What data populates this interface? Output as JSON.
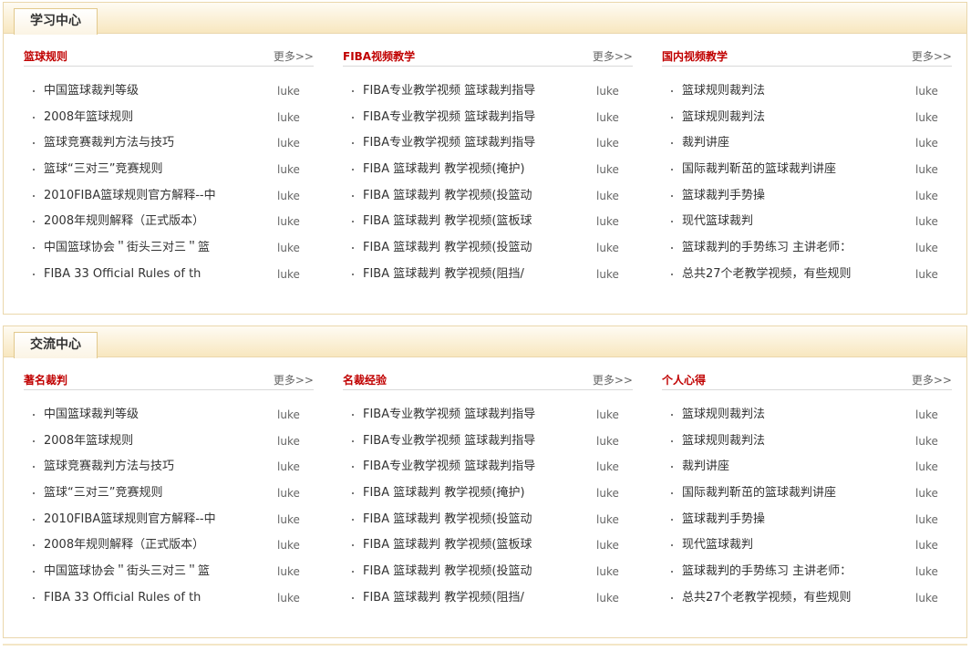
{
  "panels": [
    {
      "tab": "学习中心",
      "columns": [
        {
          "title": "篮球规则",
          "more": "更多>>",
          "items": [
            {
              "title": "中国篮球裁判等级",
              "author": "luke"
            },
            {
              "title": "2008年篮球规则",
              "author": "luke"
            },
            {
              "title": "篮球竞赛裁判方法与技巧",
              "author": "luke"
            },
            {
              "title": "篮球“三对三”竞赛规则",
              "author": "luke"
            },
            {
              "title": "2010FIBA篮球规则官方解释--中",
              "author": "luke"
            },
            {
              "title": "2008年规则解释（正式版本）",
              "author": "luke"
            },
            {
              "title": "中国篮球协会＂街头三对三＂篮",
              "author": "luke"
            },
            {
              "title": "FIBA 33 Official Rules of th",
              "author": "luke"
            }
          ]
        },
        {
          "title": "FIBA视频教学",
          "more": "更多>>",
          "items": [
            {
              "title": "FIBA专业教学视频 篮球裁判指导",
              "author": "luke"
            },
            {
              "title": "FIBA专业教学视频 篮球裁判指导",
              "author": "luke"
            },
            {
              "title": "FIBA专业教学视频 篮球裁判指导",
              "author": "luke"
            },
            {
              "title": "FIBA 篮球裁判 教学视频(掩护)",
              "author": "luke"
            },
            {
              "title": "FIBA 篮球裁判 教学视频(投篮动",
              "author": "luke"
            },
            {
              "title": "FIBA 篮球裁判 教学视频(篮板球",
              "author": "luke"
            },
            {
              "title": "FIBA 篮球裁判 教学视频(投篮动",
              "author": "luke"
            },
            {
              "title": "FIBA 篮球裁判 教学视频(阻挡/",
              "author": "luke"
            }
          ]
        },
        {
          "title": "国内视频教学",
          "more": "更多>>",
          "items": [
            {
              "title": "篮球规则裁判法",
              "author": "luke"
            },
            {
              "title": "篮球规则裁判法",
              "author": "luke"
            },
            {
              "title": "裁判讲座",
              "author": "luke"
            },
            {
              "title": "国际裁判靳茁的篮球裁判讲座",
              "author": "luke"
            },
            {
              "title": "篮球裁判手势操",
              "author": "luke"
            },
            {
              "title": "现代篮球裁判",
              "author": "luke"
            },
            {
              "title": "篮球裁判的手势练习 主讲老师：",
              "author": "luke"
            },
            {
              "title": "总共27个老教学视频，有些规则",
              "author": "luke"
            }
          ]
        }
      ]
    },
    {
      "tab": "交流中心",
      "columns": [
        {
          "title": "著名裁判",
          "more": "更多>>",
          "items": [
            {
              "title": "中国篮球裁判等级",
              "author": "luke"
            },
            {
              "title": "2008年篮球规则",
              "author": "luke"
            },
            {
              "title": "篮球竞赛裁判方法与技巧",
              "author": "luke"
            },
            {
              "title": "篮球“三对三”竞赛规则",
              "author": "luke"
            },
            {
              "title": "2010FIBA篮球规则官方解释--中",
              "author": "luke"
            },
            {
              "title": "2008年规则解释（正式版本）",
              "author": "luke"
            },
            {
              "title": "中国篮球协会＂街头三对三＂篮",
              "author": "luke"
            },
            {
              "title": "FIBA 33 Official Rules of th",
              "author": "luke"
            }
          ]
        },
        {
          "title": "名裁经验",
          "more": "更多>>",
          "items": [
            {
              "title": "FIBA专业教学视频 篮球裁判指导",
              "author": "luke"
            },
            {
              "title": "FIBA专业教学视频 篮球裁判指导",
              "author": "luke"
            },
            {
              "title": "FIBA专业教学视频 篮球裁判指导",
              "author": "luke"
            },
            {
              "title": "FIBA 篮球裁判 教学视频(掩护)",
              "author": "luke"
            },
            {
              "title": "FIBA 篮球裁判 教学视频(投篮动",
              "author": "luke"
            },
            {
              "title": "FIBA 篮球裁判 教学视频(篮板球",
              "author": "luke"
            },
            {
              "title": "FIBA 篮球裁判 教学视频(投篮动",
              "author": "luke"
            },
            {
              "title": "FIBA 篮球裁判 教学视频(阻挡/",
              "author": "luke"
            }
          ]
        },
        {
          "title": "个人心得",
          "more": "更多>>",
          "items": [
            {
              "title": "篮球规则裁判法",
              "author": "luke"
            },
            {
              "title": "篮球规则裁判法",
              "author": "luke"
            },
            {
              "title": "裁判讲座",
              "author": "luke"
            },
            {
              "title": "国际裁判靳茁的篮球裁判讲座",
              "author": "luke"
            },
            {
              "title": "篮球裁判手势操",
              "author": "luke"
            },
            {
              "title": "现代篮球裁判",
              "author": "luke"
            },
            {
              "title": "篮球裁判的手势练习 主讲老师：",
              "author": "luke"
            },
            {
              "title": "总共27个老教学视频，有些规则",
              "author": "luke"
            }
          ]
        }
      ]
    }
  ],
  "colors": {
    "accent_red": "#c00000",
    "panel_border": "#ead7ac",
    "header_gradient_bottom": "#f8e7bf"
  }
}
